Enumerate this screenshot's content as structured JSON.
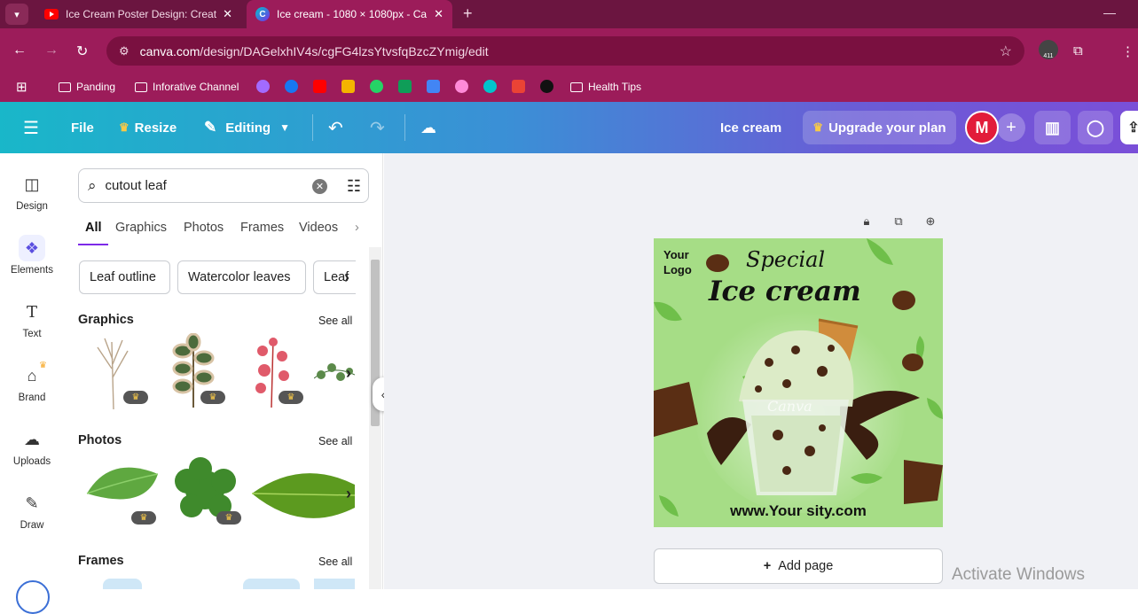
{
  "browser": {
    "tabs": [
      {
        "title": "Ice Cream Poster Design: Creati"
      },
      {
        "title": "Ice cream - 1080 × 1080px - Ca"
      }
    ],
    "url_domain": "canva.com",
    "url_path": "/design/DAGelxhIV4s/cgFG4lzsYtvsfqBzcZYmig/edit",
    "ext_badge": "411",
    "bookmarks": [
      "Panding",
      "Inforative Channel",
      "Health Tips"
    ]
  },
  "toolbar": {
    "file": "File",
    "resize": "Resize",
    "editing": "Editing",
    "doc_title": "Ice cream",
    "upgrade": "Upgrade your plan",
    "avatar": "M"
  },
  "rail": [
    "Design",
    "Elements",
    "Text",
    "Brand",
    "Uploads",
    "Draw"
  ],
  "panel": {
    "search_value": "cutout leaf",
    "tabs": [
      "All",
      "Graphics",
      "Photos",
      "Frames",
      "Videos"
    ],
    "chips": [
      "Leaf outline",
      "Watercolor leaves",
      "Leaf"
    ],
    "sections": {
      "graphics": "Graphics",
      "photos": "Photos",
      "frames": "Frames"
    },
    "see_all": "See all"
  },
  "design": {
    "logo": [
      "Your",
      "Logo"
    ],
    "special": "Special",
    "headline": "Ice cream",
    "website": "www.Your sity.com",
    "wm": "Canva"
  },
  "add_page": "Add page",
  "watermark": "Activate Windows",
  "colors": {
    "canva_purple": "#7d2ae8",
    "browser": "#9c1c5a",
    "design_bg": "#a6dd86"
  }
}
